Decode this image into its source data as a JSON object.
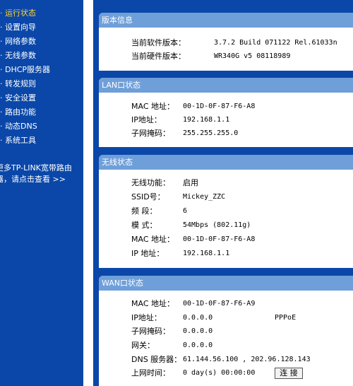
{
  "sidebar": {
    "items": [
      {
        "label": "运行状态",
        "active": true
      },
      {
        "label": "设置向导",
        "active": false
      },
      {
        "label": "网络参数",
        "active": false
      },
      {
        "label": "无线参数",
        "active": false
      },
      {
        "label": "DHCP服务器",
        "active": false
      },
      {
        "label": "转发规则",
        "active": false
      },
      {
        "label": "安全设置",
        "active": false
      },
      {
        "label": "路由功能",
        "active": false
      },
      {
        "label": "动态DNS",
        "active": false
      },
      {
        "label": "系统工具",
        "active": false
      }
    ],
    "more_line1": "更多TP-LINK宽带路由",
    "more_line2": "器，请点击查看 >>"
  },
  "version": {
    "title": "版本信息",
    "software_label": "当前软件版本：",
    "software_value": "3.7.2 Build 071122 Rel.61033n",
    "hardware_label": "当前硬件版本：",
    "hardware_value": "WR340G v5 08118989"
  },
  "lan": {
    "title": "LAN口状态",
    "mac_label": "MAC 地址：",
    "mac_value": "00-1D-0F-87-F6-A8",
    "ip_label": "IP地址：",
    "ip_value": "192.168.1.1",
    "mask_label": "子网掩码：",
    "mask_value": "255.255.255.0"
  },
  "wireless": {
    "title": "无线状态",
    "func_label": "无线功能：",
    "func_value": "启用",
    "ssid_label": "SSID号：",
    "ssid_value": "Mickey_ZZC",
    "channel_label": "频  段：",
    "channel_value": "6",
    "mode_label": "模  式：",
    "mode_value": "54Mbps (802.11g)",
    "mac_label": "MAC 地址：",
    "mac_value": "00-1D-0F-87-F6-A8",
    "ip_label": "IP 地址：",
    "ip_value": "192.168.1.1"
  },
  "wan": {
    "title": "WAN口状态",
    "mac_label": "MAC 地址：",
    "mac_value": "00-1D-0F-87-F6-A9",
    "ip_label": "IP地址：",
    "ip_value": "0.0.0.0",
    "conn_type": "PPPoE",
    "mask_label": "子网掩码：",
    "mask_value": "0.0.0.0",
    "gateway_label": "网关：",
    "gateway_value": "0.0.0.0",
    "dns_label": "DNS 服务器：",
    "dns_value": "61.144.56.100 , 202.96.128.143",
    "uptime_label": "上网时间：",
    "uptime_value": "0 day(s) 00:00:00",
    "connect_button": "连 接"
  },
  "colors": {
    "sidebar_bg": "#0a47a8",
    "active_menu": "#ffd23a",
    "panel_header": "#6f9fd9"
  }
}
